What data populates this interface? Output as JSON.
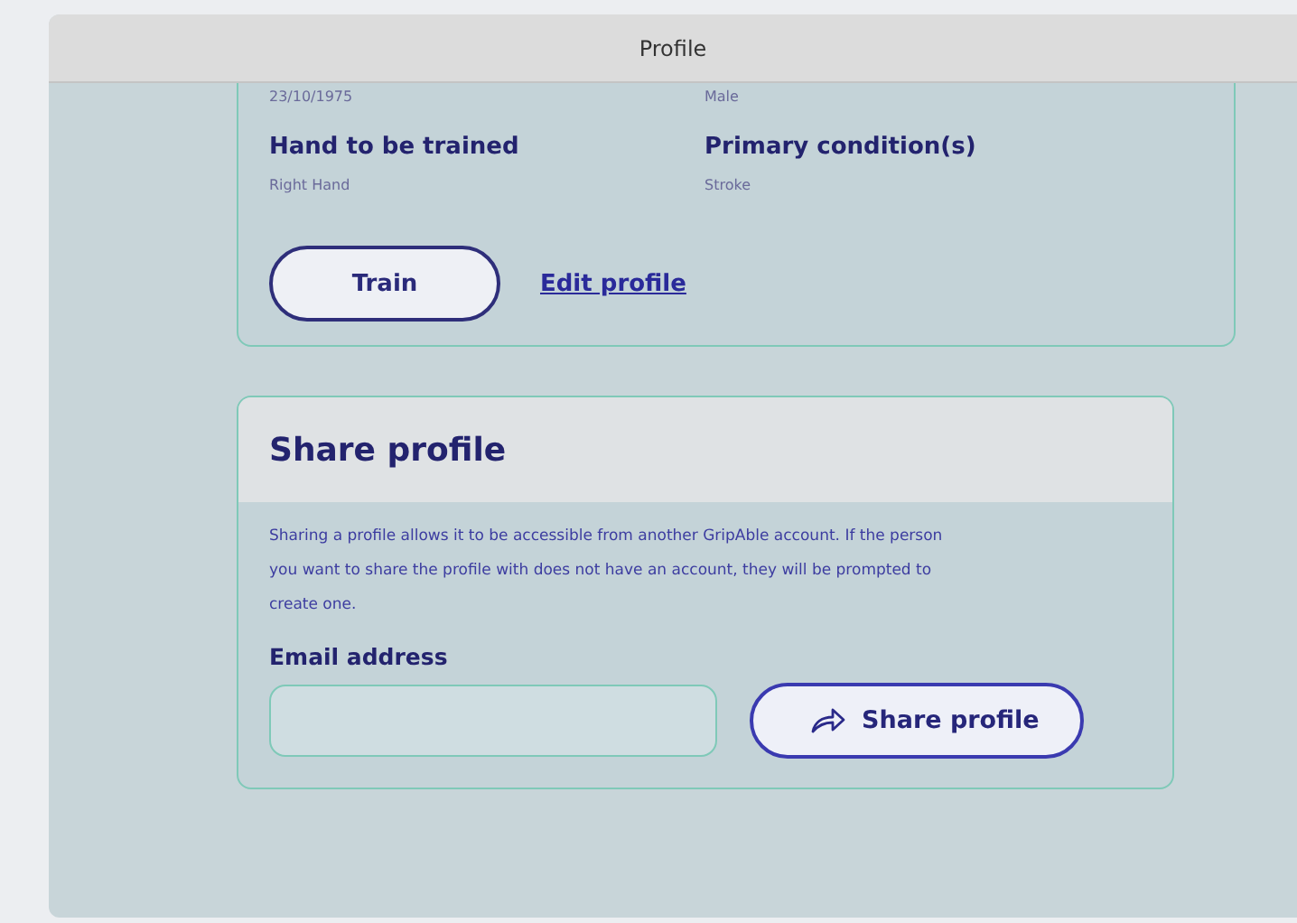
{
  "window": {
    "title": "Profile"
  },
  "profile_card": {
    "fields": [
      {
        "value": "23/10/1975"
      },
      {
        "value": "Male"
      },
      {
        "label": "Hand to be trained",
        "value": "Right Hand"
      },
      {
        "label": "Primary condition(s)",
        "value": "Stroke"
      }
    ],
    "train_button": "Train",
    "edit_link": "Edit profile"
  },
  "share_card": {
    "title": "Share profile",
    "description": "Sharing a profile allows it to be accessible from another GripAble account. If the person you want to share the profile with does not have an account, they will be prompted to create one.",
    "email_label": "Email address",
    "share_button": "Share profile"
  }
}
